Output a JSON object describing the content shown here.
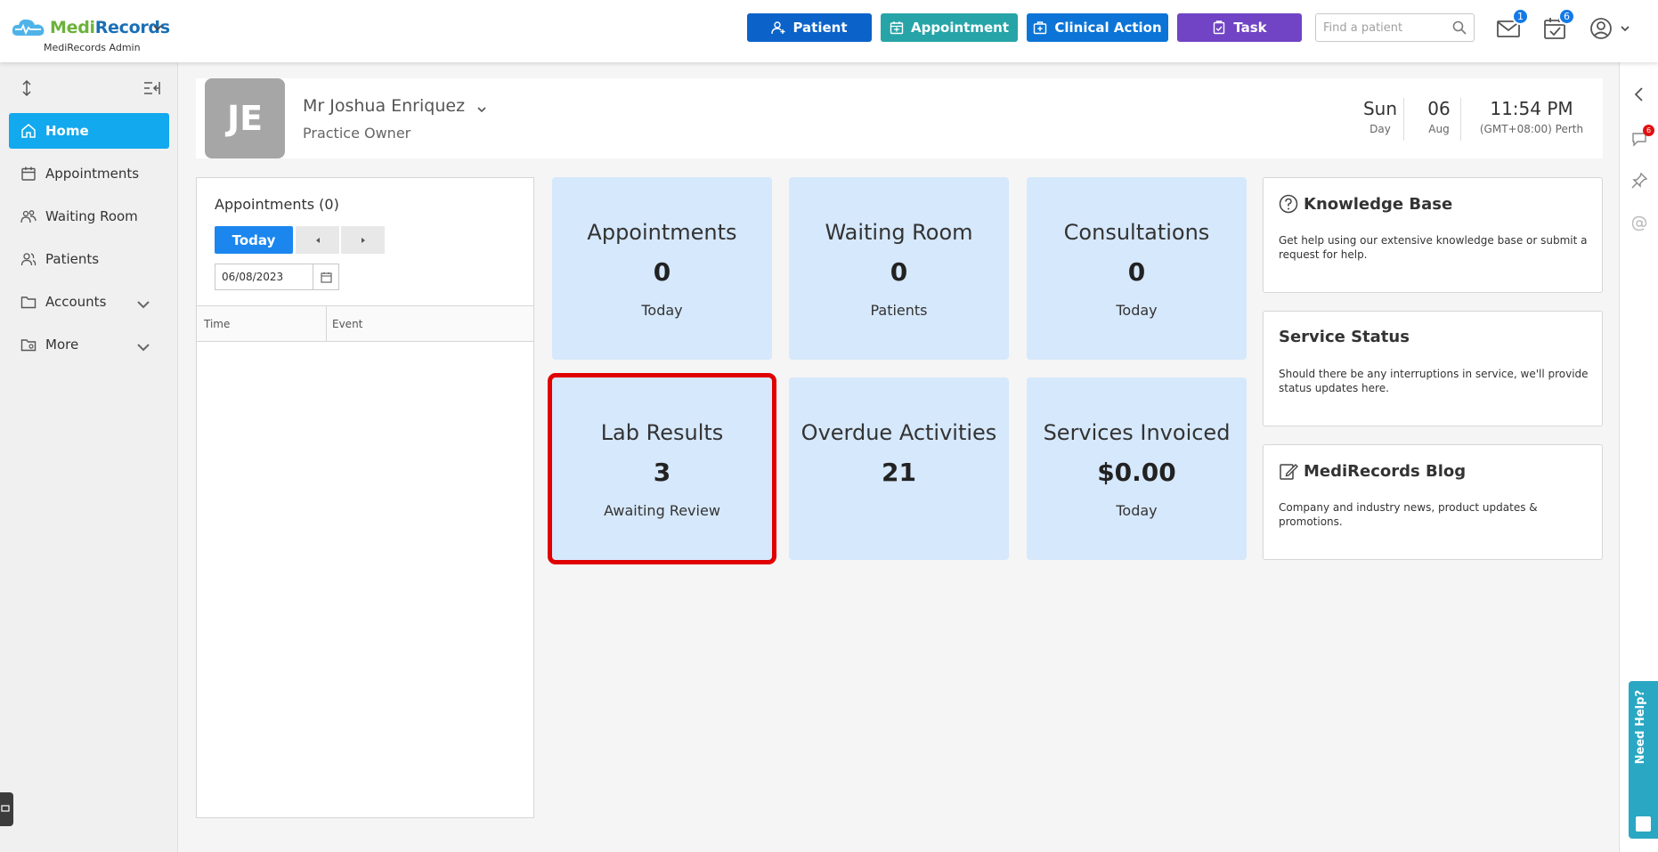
{
  "brand": {
    "name_part1": "Medi",
    "name_part2": "Records",
    "org": "MediRecords Admin"
  },
  "topbar": {
    "buttons": {
      "patient": "Patient",
      "appointment": "Appointment",
      "clinical": "Clinical Action",
      "task": "Task"
    },
    "search_placeholder": "Find a patient",
    "mail_count": "1",
    "tasks_count": "6"
  },
  "sidebar": {
    "items": [
      {
        "label": "Home"
      },
      {
        "label": "Appointments"
      },
      {
        "label": "Waiting Room"
      },
      {
        "label": "Patients"
      },
      {
        "label": "Accounts"
      },
      {
        "label": "More"
      }
    ]
  },
  "profile": {
    "initials": "JE",
    "name": "Mr Joshua Enriquez",
    "role": "Practice Owner",
    "day": "Sun",
    "day_label": "Day",
    "date": "06",
    "month": "Aug",
    "time": "11:54 PM",
    "tz": "(GMT+08:00) Perth"
  },
  "appointments_panel": {
    "title": "Appointments (0)",
    "today_label": "Today",
    "date_value": "06/08/2023",
    "columns": [
      "Time",
      "Event"
    ]
  },
  "tiles": [
    {
      "title": "Appointments",
      "value": "0",
      "sub": "Today"
    },
    {
      "title": "Waiting Room",
      "value": "0",
      "sub": "Patients"
    },
    {
      "title": "Consultations",
      "value": "0",
      "sub": "Today"
    },
    {
      "title": "Lab Results",
      "value": "3",
      "sub": "Awaiting Review"
    },
    {
      "title": "Overdue Activities",
      "value": "21",
      "sub": ""
    },
    {
      "title": "Services Invoiced",
      "value": "$0.00",
      "sub": "Today"
    }
  ],
  "info_cards": [
    {
      "title": "Knowledge Base",
      "body": "Get help using our extensive knowledge base or submit a request for help."
    },
    {
      "title": "Service Status",
      "body": "Should there be any interruptions in service, we'll provide status updates here."
    },
    {
      "title": "MediRecords Blog",
      "body": "Company and industry news, product updates & promotions."
    }
  ],
  "right_rail": {
    "notif_count": "6"
  },
  "need_help": "Need Help?",
  "colors": {
    "accent": "#12a9ee",
    "tile_bg": "#d6e8fb",
    "highlight": "#e00000"
  }
}
